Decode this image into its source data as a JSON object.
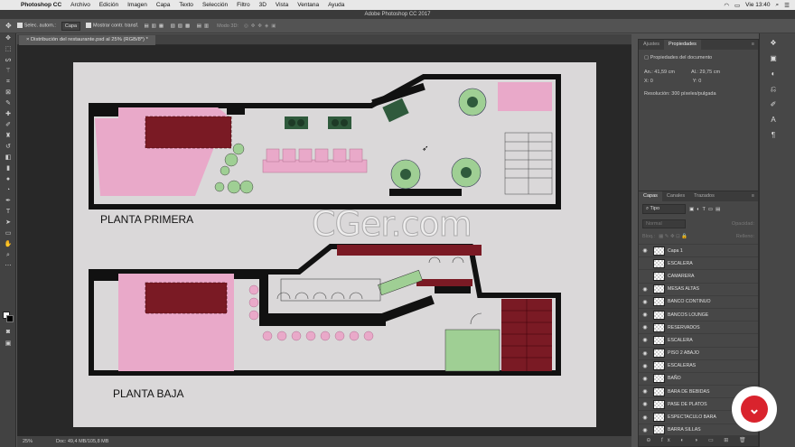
{
  "menubar": {
    "app": "Photoshop CC",
    "items": [
      "Archivo",
      "Edición",
      "Imagen",
      "Capa",
      "Texto",
      "Selección",
      "Filtro",
      "3D",
      "Vista",
      "Ventana",
      "Ayuda"
    ],
    "clock": "Vie 13:40"
  },
  "window_title": "Adobe Photoshop CC 2017",
  "options": {
    "auto_select_label": "Selec. autom.:",
    "auto_select_value": "Capa",
    "show_transform": "Mostrar contr. transf.",
    "mode_3d": "Modo 3D:"
  },
  "document_tab": "Distribución del restaurante.psd al 25% (RGB/8*) *",
  "status": {
    "zoom": "25%",
    "doc": "Doc: 49,4 MB/105,8 MB"
  },
  "properties_panel": {
    "tabs": [
      "Ajustes",
      "Propiedades"
    ],
    "heading": "Propiedades del documento",
    "an": "An.: 41,59 cm",
    "al": "Al.: 29,75 cm",
    "x": "X: 0",
    "y": "Y: 0",
    "resolution": "Resolución: 300 píxeles/pulgada"
  },
  "layers_panel": {
    "tabs": [
      "Capas",
      "Canales",
      "Trazados"
    ],
    "filter": "Tipo",
    "blend": "Normal",
    "opacity_label": "Opacidad:",
    "lock_label": "Bloq.:",
    "fill_label": "Relleno:",
    "layers": [
      {
        "name": "Capa 1",
        "visible": true
      },
      {
        "name": "ESCALERA",
        "visible": false
      },
      {
        "name": "CAMARERA",
        "visible": false
      },
      {
        "name": "MESAS ALTAS",
        "visible": true
      },
      {
        "name": "BANCO CONTINUO",
        "visible": true
      },
      {
        "name": "BANCOS LOUNGE",
        "visible": true
      },
      {
        "name": "RESERVADOS",
        "visible": true
      },
      {
        "name": "ESCALERA",
        "visible": true
      },
      {
        "name": "PISO 2 ABAJO",
        "visible": true
      },
      {
        "name": "ESCALERAS",
        "visible": true
      },
      {
        "name": "BAÑO",
        "visible": true
      },
      {
        "name": "BARA DE BEBIDAS",
        "visible": true
      },
      {
        "name": "PASE DE PLATOS",
        "visible": true
      },
      {
        "name": "ESPECTACULO BARA",
        "visible": true
      },
      {
        "name": "BARRA SILLAS",
        "visible": true
      }
    ]
  },
  "plan": {
    "upper_label": "PLANTA PRIMERA",
    "lower_label": "PLANTA BAJA"
  },
  "watermark": "CGer.com"
}
